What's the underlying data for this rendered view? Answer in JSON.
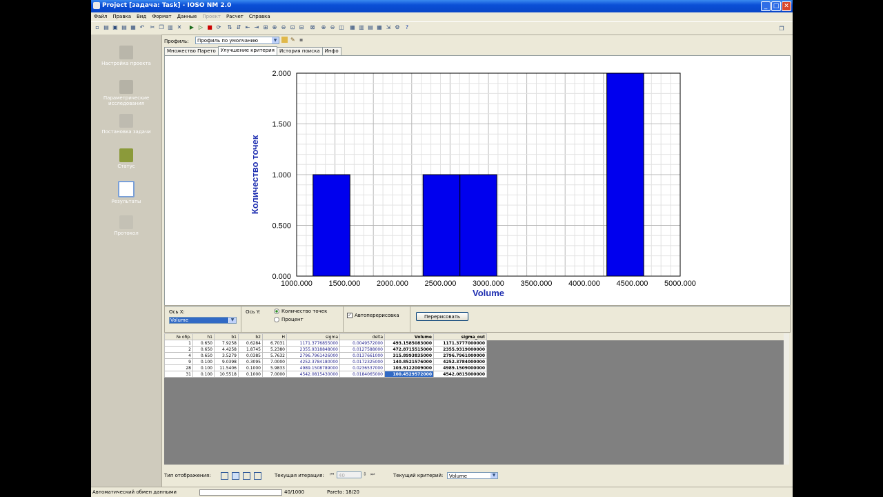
{
  "window": {
    "title": "Project [задача: Task] - IOSO NM 2.0"
  },
  "menu": {
    "items": [
      "Файл",
      "Правка",
      "Вид",
      "Формат",
      "Данные",
      "Проект",
      "Расчет",
      "Справка"
    ],
    "disabled": [
      5
    ]
  },
  "sidebar": {
    "items": [
      {
        "label": "Настройка проекта",
        "icon": "project-setup-icon",
        "active": false
      },
      {
        "label": "Параметрические исследования",
        "icon": "parametric-study-icon",
        "active": false
      },
      {
        "label": "Постановка задачи",
        "icon": "task-statement-icon",
        "active": false
      },
      {
        "label": "Статус",
        "icon": "status-icon",
        "active": false
      },
      {
        "label": "Результаты",
        "icon": "results-icon",
        "active": true
      },
      {
        "label": "Протокол",
        "icon": "protocol-icon",
        "active": false
      }
    ]
  },
  "profile": {
    "label": "Профиль:",
    "value": "Профиль по умолчанию"
  },
  "tabs": [
    {
      "label": "Множество Парето",
      "active": false
    },
    {
      "label": "Улучшение критерия",
      "active": true
    },
    {
      "label": "История поиска",
      "active": false
    },
    {
      "label": "Инфо",
      "active": false
    }
  ],
  "chart_data": {
    "type": "bar",
    "title": "",
    "xlabel": "Volume",
    "ylabel": "Количество точек",
    "xlim": [
      1000,
      5000
    ],
    "ylim": [
      0,
      2
    ],
    "x_ticks": [
      "1000.000",
      "1500.000",
      "2000.000",
      "2500.000",
      "3000.000",
      "3500.000",
      "4000.000",
      "4500.000",
      "5000.000"
    ],
    "y_ticks": [
      "0.000",
      "0.500",
      "1.000",
      "1.500",
      "2.000"
    ],
    "bin_width": 385,
    "bins": [
      {
        "start": 1171,
        "value": 1
      },
      {
        "start": 2318,
        "value": 1
      },
      {
        "start": 2703,
        "value": 1
      },
      {
        "start": 4235,
        "value": 2
      }
    ],
    "grid": true,
    "bar_color": "#0000ee"
  },
  "controls": {
    "axis_x_label": "Ось X:",
    "axis_x_value": "Volume",
    "axis_y_label": "Ось Y:",
    "radio_count": "Количество точек",
    "radio_percent": "Процент",
    "auto_redraw": "Автоперерисовка",
    "redraw_button": "Перерисовать"
  },
  "table": {
    "columns": [
      "№ обр.",
      "h1",
      "b1",
      "b2",
      "H",
      "sigma",
      "delta",
      "Volume",
      "sigma_out"
    ],
    "rows": [
      [
        "1",
        "0.650",
        "7.9258",
        "0.6284",
        "6.7031",
        "1171.3776855000",
        "0.0049572000",
        "493.1585083000",
        "1171.3777000000"
      ],
      [
        "2",
        "0.650",
        "4.4258",
        "1.8745",
        "5.2380",
        "2355.9318848000",
        "0.0127588000",
        "472.8715515000",
        "2355.9319000000"
      ],
      [
        "4",
        "0.650",
        "3.5279",
        "0.0385",
        "5.7632",
        "2796.7961426000",
        "0.0137661000",
        "315.8993835000",
        "2796.7961000000"
      ],
      [
        "9",
        "0.100",
        "9.0398",
        "0.3095",
        "7.0000",
        "4252.3784180000",
        "0.0172325000",
        "140.8521576000",
        "4252.3784000000"
      ],
      [
        "28",
        "0.100",
        "11.5406",
        "0.1000",
        "5.9833",
        "4989.1508789000",
        "0.0236537000",
        "103.9122009000",
        "4989.1509000000"
      ],
      [
        "31",
        "0.100",
        "10.5518",
        "0.1000",
        "7.0000",
        "4542.0815430000",
        "0.0184065000",
        "100.4529572000",
        "4542.0815000000"
      ]
    ]
  },
  "bottom": {
    "display_type_label": "Тип отображения:",
    "iteration_label": "Текущая итерация:",
    "iteration_value": "40",
    "criterion_label": "Текущий критерий:",
    "criterion_value": "Volume"
  },
  "status": {
    "message": "Автоматический обмен данными",
    "progress": "40/1000",
    "pareto": "Pareto: 18/20"
  }
}
